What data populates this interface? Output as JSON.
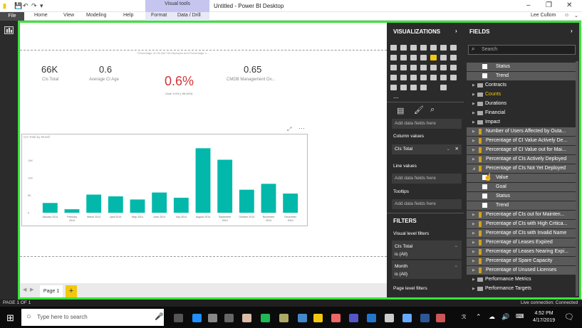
{
  "titlebar": {
    "title": "Untitled - Power BI Desktop",
    "context_tab": "Visual tools",
    "minimize": "–",
    "restore": "❐",
    "close": "✕"
  },
  "ribbon": {
    "tabs": [
      "File",
      "Home",
      "View",
      "Modeling",
      "Help",
      "Format",
      "Data / Drill"
    ],
    "user": "Lee Cullom"
  },
  "canvas": {
    "gauge_subtitle": "Percentage of CIs Not Yet Deployed and Percentage o...",
    "cards": [
      {
        "value": "66K",
        "label": "CIs Total"
      },
      {
        "value": "0.6",
        "label": "Average CI Age"
      },
      {
        "value": "0.65",
        "label": "CMDB Management Ov..."
      }
    ],
    "gauge_value": "0.6%",
    "gauge_goal": "Goal: 0.0% (-98.34%)",
    "chart_title": "CIs Total by Month"
  },
  "chart_data": {
    "type": "bar",
    "title": "CIs Total by Month",
    "categories": [
      "January 2014",
      "February 2014",
      "March 2014",
      "April 2014",
      "May 2014",
      "June 2014",
      "July 2014",
      "August 2014",
      "September 2014",
      "October 2014",
      "November 2014",
      "December 2014"
    ],
    "values": [
      2.8,
      1.0,
      5.2,
      4.7,
      3.8,
      5.8,
      4.3,
      18.5,
      15.2,
      6.6,
      8.3,
      5.5
    ],
    "y_ticks": [
      "0",
      "5K",
      "10K",
      "15K"
    ],
    "ylim": [
      0,
      20
    ],
    "color": "#01b8aa",
    "grid": false
  },
  "pagetabs": {
    "page": "Page 1",
    "add": "+"
  },
  "visualizations": {
    "header": "VISUALIZATIONS",
    "more": "...",
    "wells": [
      {
        "placeholder": "Add data fields here"
      },
      {
        "label": "Column values",
        "value": "CIs Total"
      },
      {
        "label": "Line values",
        "placeholder": "Add data fields here"
      },
      {
        "label": "Tooltips",
        "placeholder": "Add data fields here"
      }
    ],
    "filters_header": "FILTERS",
    "visual_level": "Visual level filters",
    "filters": [
      {
        "name": "CIs Total",
        "value": "is (All)"
      },
      {
        "name": "Month",
        "value": "is (All)"
      }
    ],
    "page_level": "Page level filters"
  },
  "fields": {
    "header": "FIELDS",
    "search_placeholder": "Search",
    "items": [
      {
        "type": "check",
        "text": "Status"
      },
      {
        "type": "check",
        "text": "Trend"
      },
      {
        "type": "folder",
        "text": "Contracts"
      },
      {
        "type": "folder",
        "text": "Counts"
      },
      {
        "type": "folder",
        "text": "Durations"
      },
      {
        "type": "folder",
        "text": "Financial"
      },
      {
        "type": "folder",
        "text": "Impact"
      },
      {
        "type": "measure",
        "text": "Number of Users Affected by Outa..."
      },
      {
        "type": "measure",
        "text": "Percentage of CI Value Actively De..."
      },
      {
        "type": "measure",
        "text": "Percentage of CI Value out for Mai..."
      },
      {
        "type": "measure",
        "text": "Percentage of CIs Actively Deployed"
      },
      {
        "type": "measure",
        "text": "Percentage of CIs Not Yet Deployed"
      },
      {
        "type": "check",
        "text": "Value"
      },
      {
        "type": "check",
        "text": "Goal"
      },
      {
        "type": "check",
        "text": "Status"
      },
      {
        "type": "check",
        "text": "Trend"
      },
      {
        "type": "measure",
        "text": "Percentage of CIs out for Mainten..."
      },
      {
        "type": "measure",
        "text": "Percentage of CIs with High Critica..."
      },
      {
        "type": "measure",
        "text": "Percentage of CIs with Invalid Name"
      },
      {
        "type": "measure",
        "text": "Percentage of Leases Expired"
      },
      {
        "type": "measure",
        "text": "Percentage of Leases Nearing Expi..."
      },
      {
        "type": "measure",
        "text": "Percentage of Spare Capacity"
      },
      {
        "type": "measure",
        "text": "Percentage of Unused Licenses"
      },
      {
        "type": "folder",
        "text": "Performance Metrics"
      },
      {
        "type": "folder",
        "text": "Performance Targets"
      }
    ]
  },
  "status": {
    "left": "PAGE 1 OF 1",
    "right": "Live connection: Connected"
  },
  "taskbar": {
    "search": "Type here to search",
    "time": "4:52 PM",
    "date": "4/17/2019"
  }
}
